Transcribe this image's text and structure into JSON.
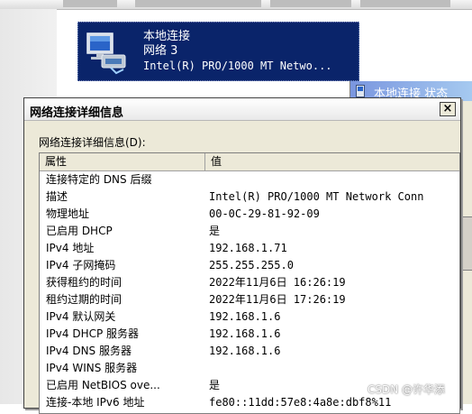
{
  "connection_tile": {
    "name": "本地连接",
    "network": "网络  3",
    "adapter": "Intel(R) PRO/1000 MT Netwo..."
  },
  "status_window": {
    "title": "本地连接 状态"
  },
  "details_dialog": {
    "title": "网络连接详细信息",
    "close_label": "×",
    "list_label": "网络连接详细信息(D):",
    "columns": [
      "属性",
      "值"
    ],
    "rows": [
      {
        "property": "连接特定的 DNS 后缀",
        "value": ""
      },
      {
        "property": "描述",
        "value": "Intel(R) PRO/1000 MT Network Conn"
      },
      {
        "property": "物理地址",
        "value": "00-0C-29-81-92-09"
      },
      {
        "property": "已启用 DHCP",
        "value": "是"
      },
      {
        "property": "IPv4 地址",
        "value": "192.168.1.71"
      },
      {
        "property": "IPv4 子网掩码",
        "value": "255.255.255.0"
      },
      {
        "property": "获得租约的时间",
        "value": "2022年11月6日 16:26:19"
      },
      {
        "property": "租约过期的时间",
        "value": "2022年11月6日 17:26:19"
      },
      {
        "property": "IPv4 默认网关",
        "value": "192.168.1.6"
      },
      {
        "property": "IPv4 DHCP 服务器",
        "value": "192.168.1.6"
      },
      {
        "property": "IPv4 DNS 服务器",
        "value": "192.168.1.6"
      },
      {
        "property": "IPv4 WINS 服务器",
        "value": ""
      },
      {
        "property": "已启用 NetBIOS ove...",
        "value": "是"
      },
      {
        "property": "连接-本地 IPv6 地址",
        "value": "fe80::11dd:57e8:4a8e:dbf8%11"
      }
    ]
  },
  "watermark": "CSDN @许华添",
  "colors": {
    "tile_bg": "#0a246a",
    "dialog_bg": "#ece9d8",
    "status_title": "#7a96df"
  },
  "icons": [
    "network-connection-icon",
    "status-window-icon",
    "close-icon"
  ]
}
